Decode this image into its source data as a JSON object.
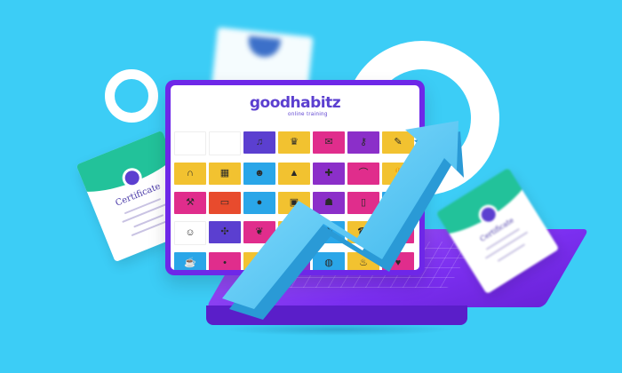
{
  "brand": {
    "logo_text": "goodhabitz",
    "tagline": "online training"
  },
  "certificate_left": {
    "title": "Certificate"
  },
  "certificate_right": {
    "title": "Certificate"
  },
  "course_tiles": [
    {
      "color": "#ffffff",
      "icon": "blank-tile"
    },
    {
      "color": "#ffffff",
      "icon": "blank-tile"
    },
    {
      "color": "#5b3fd0",
      "icon": "headphones-icon"
    },
    {
      "color": "#f2c230",
      "icon": "trophy-icon"
    },
    {
      "color": "#e02d8c",
      "icon": "note-icon"
    },
    {
      "color": "#8b2fc9",
      "icon": "key-icon"
    },
    {
      "color": "#f2c230",
      "icon": "pencil-icon"
    },
    {
      "color": "#f2c230",
      "icon": "magnet-icon"
    },
    {
      "color": "#f2c230",
      "icon": "clapper-icon"
    },
    {
      "color": "#2aa6e8",
      "icon": "people-icon"
    },
    {
      "color": "#f2c230",
      "icon": "graph-icon"
    },
    {
      "color": "#8b2fc9",
      "icon": "puzzle-icon"
    },
    {
      "color": "#e02d8c",
      "icon": "bridge-icon"
    },
    {
      "color": "#f2c230",
      "icon": "hand-icon"
    },
    {
      "color": "#e02d8c",
      "icon": "tool-icon"
    },
    {
      "color": "#e84b2d",
      "icon": "wallet-icon"
    },
    {
      "color": "#2aa6e8",
      "icon": "balloon-icon"
    },
    {
      "color": "#f2c230",
      "icon": "radio-icon"
    },
    {
      "color": "#8b2fc9",
      "icon": "robot-icon"
    },
    {
      "color": "#e02d8c",
      "icon": "door-icon"
    },
    {
      "color": "#2aa6e8",
      "icon": "spark-icon"
    },
    {
      "color": "#ffffff",
      "icon": "portrait-icon"
    },
    {
      "color": "#5b3fd0",
      "icon": "pinwheel-icon"
    },
    {
      "color": "#e02d8c",
      "icon": "ribbon-icon"
    },
    {
      "color": "#f2c230",
      "icon": "calculator-icon"
    },
    {
      "color": "#2aa6e8",
      "icon": "plane-icon"
    },
    {
      "color": "#f2c230",
      "icon": "phone-icon"
    },
    {
      "color": "#e02d8c",
      "icon": "book-icon"
    },
    {
      "color": "#2aa6e8",
      "icon": "coffee-icon"
    },
    {
      "color": "#e02d8c",
      "icon": "dot-icon"
    },
    {
      "color": "#f2c230",
      "icon": "light-icon"
    },
    {
      "color": "#8b2fc9",
      "icon": "bag-icon"
    },
    {
      "color": "#2aa6e8",
      "icon": "globe-icon"
    },
    {
      "color": "#f2c230",
      "icon": "lamp-icon"
    },
    {
      "color": "#e02d8c",
      "icon": "heart-icon"
    },
    {
      "color": "#ffffff",
      "icon": "blank-tile"
    },
    {
      "color": "#2aa6e8",
      "icon": "gloves-icon"
    },
    {
      "color": "#f2c230",
      "icon": "clock-icon"
    },
    {
      "color": "#5b3fd0",
      "icon": "star-icon"
    },
    {
      "color": "#e02d8c",
      "icon": "cup-icon"
    },
    {
      "color": "#f2c230",
      "icon": "chart-icon"
    },
    {
      "color": "#2aa6e8",
      "icon": "cloud-icon"
    }
  ],
  "colors": {
    "background": "#3ccdf6",
    "brand_purple": "#5b3fd0",
    "laptop_purple": "#7b2ff0",
    "trend_blue": "#56c6f0"
  }
}
